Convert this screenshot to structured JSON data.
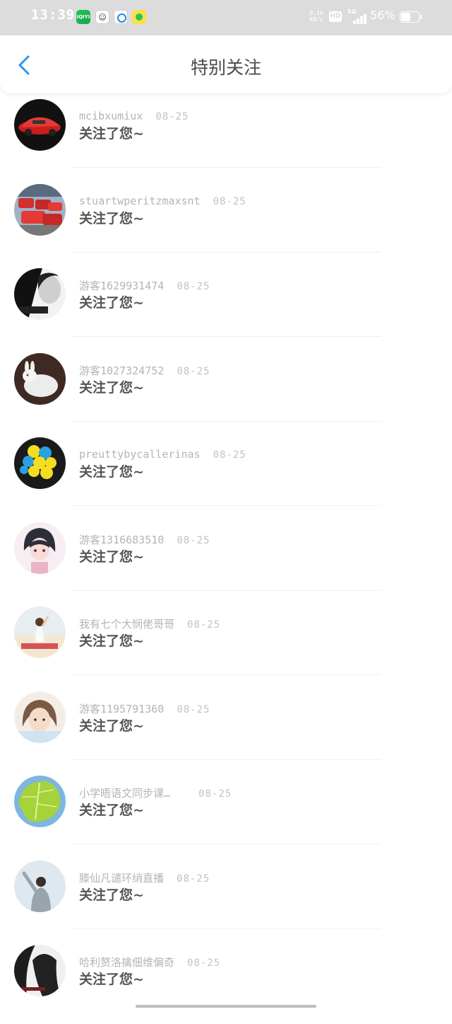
{
  "status_bar": {
    "time": "13:39",
    "apps": [
      "iQIYI",
      "qq-icon",
      "qq-browser-icon",
      "qq-music-icon"
    ],
    "net_speed_value": "0.10",
    "net_speed_unit": "KB/s",
    "hd_badge": "HD",
    "signal_label": "5G",
    "battery_percent": "56%",
    "battery_level": 0.56
  },
  "header": {
    "title": "特别关注",
    "back_icon": "chevron-left-icon",
    "accent_color": "#2b97f4"
  },
  "list": {
    "items": [
      {
        "name": "mcibxumiux",
        "date": "08-25",
        "message": "关注了您~"
      },
      {
        "name": "stuartwperitzmaxsnt",
        "date": "08-25",
        "message": "关注了您~"
      },
      {
        "name": "游客1629931474",
        "date": "08-25",
        "message": "关注了您~"
      },
      {
        "name": "游客1027324752",
        "date": "08-25",
        "message": "关注了您~"
      },
      {
        "name": "preuttybycallerinas",
        "date": "08-25",
        "message": "关注了您~"
      },
      {
        "name": "游客1316683510",
        "date": "08-25",
        "message": "关注了您~"
      },
      {
        "name": "我有七个大悯佬哥哥",
        "date": "08-25",
        "message": "关注了您~"
      },
      {
        "name": "游客1195791360",
        "date": "08-25",
        "message": "关注了您~"
      },
      {
        "name": "小学晤语文同步课…",
        "date": "08-25",
        "message": "关注了您~"
      },
      {
        "name": "滕仙凡谴环绡直播",
        "date": "08-25",
        "message": "关注了您~"
      },
      {
        "name": "哈利赘洛擒佃维偏奇",
        "date": "08-25",
        "message": "关注了您~"
      }
    ]
  }
}
